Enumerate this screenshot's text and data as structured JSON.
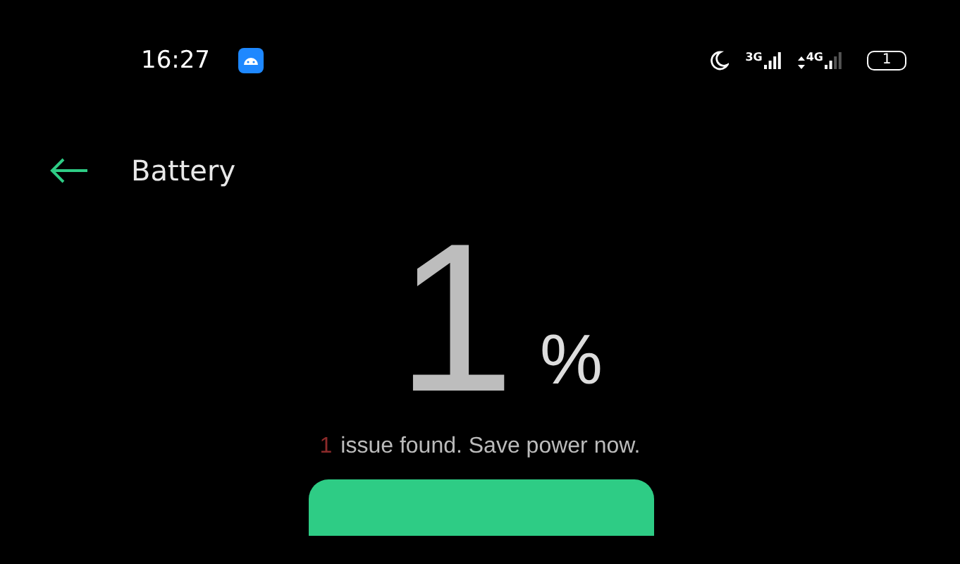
{
  "status_bar": {
    "time": "16:27",
    "network_1": "3G",
    "network_2": "4G",
    "battery": "1"
  },
  "header": {
    "title": "Battery"
  },
  "battery": {
    "percent": "1",
    "unit": "%"
  },
  "issues": {
    "count": "1",
    "message": "issue found. Save power now."
  },
  "action_button": {
    "kind": "primary"
  }
}
